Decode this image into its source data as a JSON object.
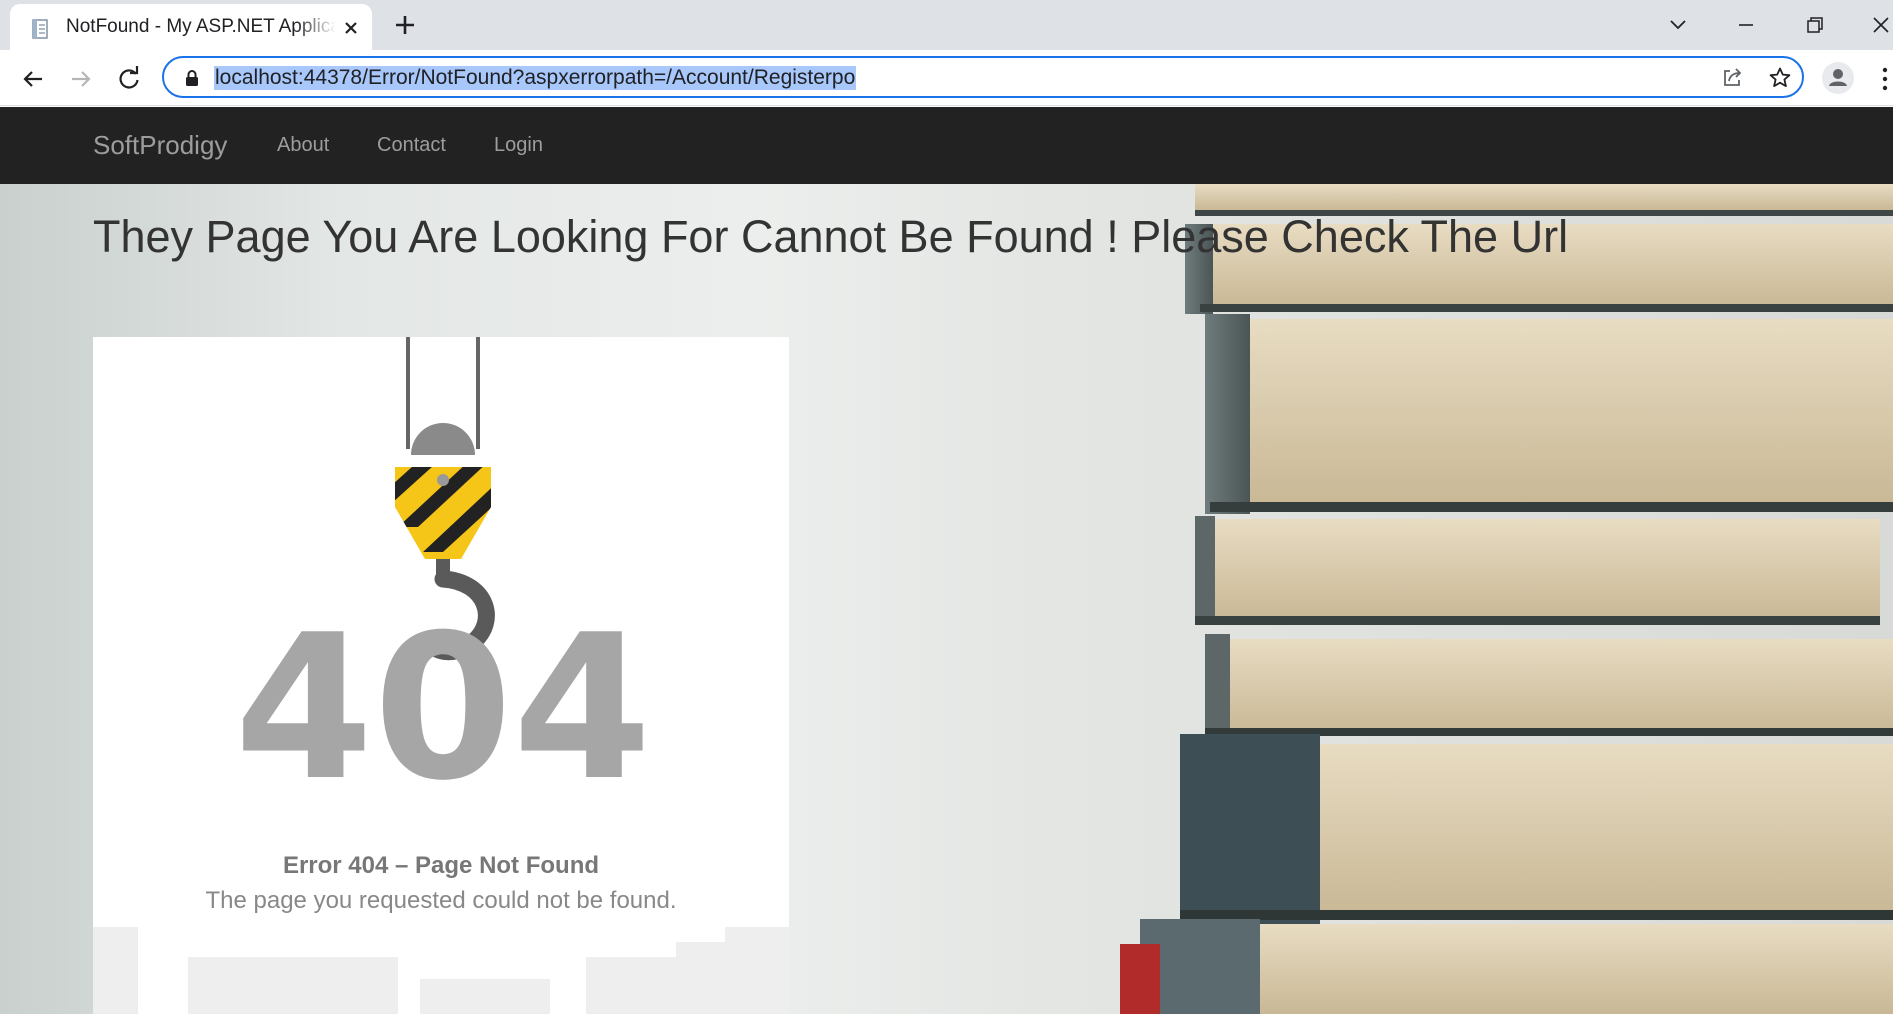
{
  "browser": {
    "tab_title": "NotFound - My ASP.NET Application",
    "url": "localhost:44378/Error/NotFound?aspxerrorpath=/Account/Registerpo",
    "accent_color": "#1a73e8",
    "selection_color": "#a8c7fa"
  },
  "navbar": {
    "brand": "SoftProdigy",
    "links": [
      "About",
      "Contact",
      "Login"
    ],
    "background": "#222222"
  },
  "main": {
    "heading": "They Page You Are Looking For Cannot Be Found ! Please Check The Url"
  },
  "error_card": {
    "code": "404",
    "title": "Error 404 – Page Not Found",
    "description": "The page you requested could not be found.",
    "hook_stripe_colors": [
      "#f5c518",
      "#222222"
    ]
  }
}
